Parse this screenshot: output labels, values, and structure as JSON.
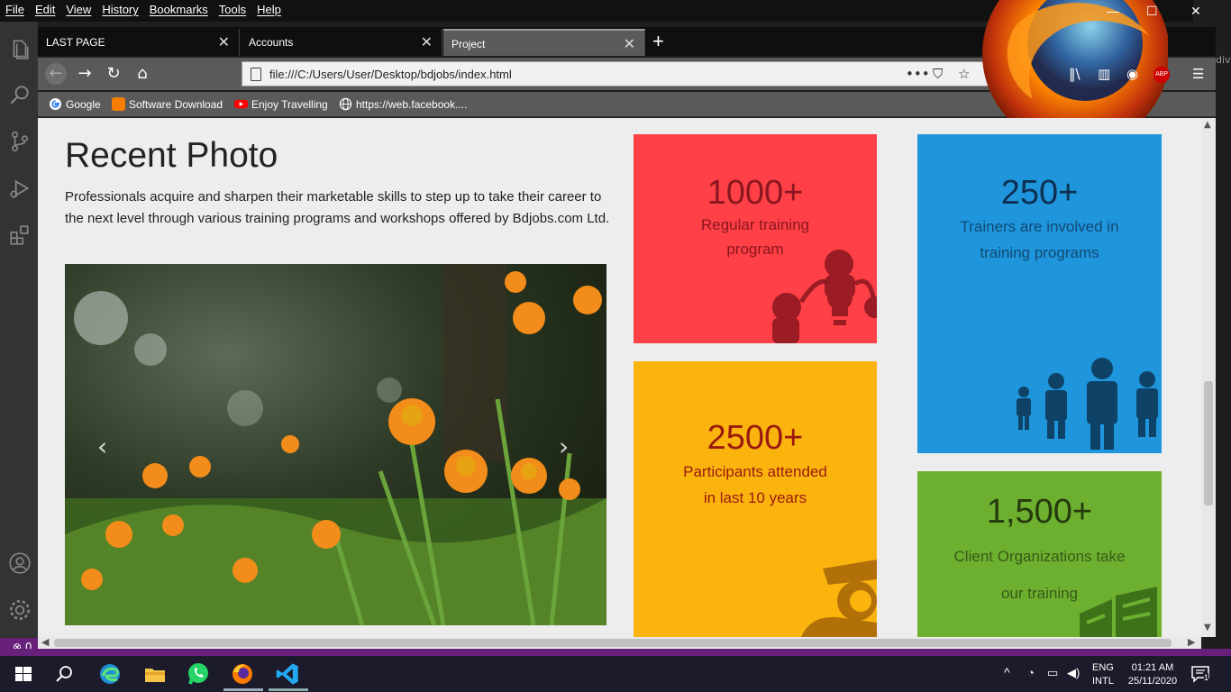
{
  "browser": {
    "menu": [
      "File",
      "Edit",
      "View",
      "History",
      "Bookmarks",
      "Tools",
      "Help"
    ],
    "window_controls": {
      "minimize": "—",
      "maximize": "☐",
      "close": "✕"
    },
    "tabs": [
      {
        "label": "LAST PAGE",
        "active": false
      },
      {
        "label": "Accounts",
        "active": false
      },
      {
        "label": "Project",
        "active": true
      }
    ],
    "new_tab": "+",
    "url": "file:///C:/Users/User/Desktop/bdjobs/index.html",
    "bookmarks": [
      {
        "label": "Google",
        "icon": "google-icon"
      },
      {
        "label": "Software Download",
        "icon": "blogger-icon"
      },
      {
        "label": "Enjoy Travelling",
        "icon": "youtube-icon"
      },
      {
        "label": "https://web.facebook....",
        "icon": "globe-icon"
      }
    ],
    "addon_badge": "ABP"
  },
  "page": {
    "title": "Recent Photo",
    "paragraph": "Professionals acquire and sharpen their marketable skills to step up to take their career to the next level through various training programs and workshops offered by Bdjobs.com Ltd.",
    "carousel": {
      "prev": "‹",
      "next": "›"
    },
    "stats": [
      {
        "number": "1000+",
        "label_line1": "Regular training",
        "label_line2": "program",
        "color": "#ff4046"
      },
      {
        "number": "250+",
        "label_line1": "Trainers are involved in",
        "label_line2": "training programs",
        "color": "#1f95dc"
      },
      {
        "number": "2500+",
        "label_line1": "Participants attended",
        "label_line2": "in last 10 years",
        "color": "#fbb40e"
      },
      {
        "number": "1,500+",
        "label_line1": "Client Organizations take",
        "label_line2": "our training",
        "color": "#6db030"
      }
    ]
  },
  "vscode": {
    "status_errors": "0",
    "gutter_text": "div."
  },
  "taskbar": {
    "lang_line1": "ENG",
    "lang_line2": "INTL",
    "time": "01:21 AM",
    "date": "25/11/2020",
    "notification_count": "1"
  }
}
